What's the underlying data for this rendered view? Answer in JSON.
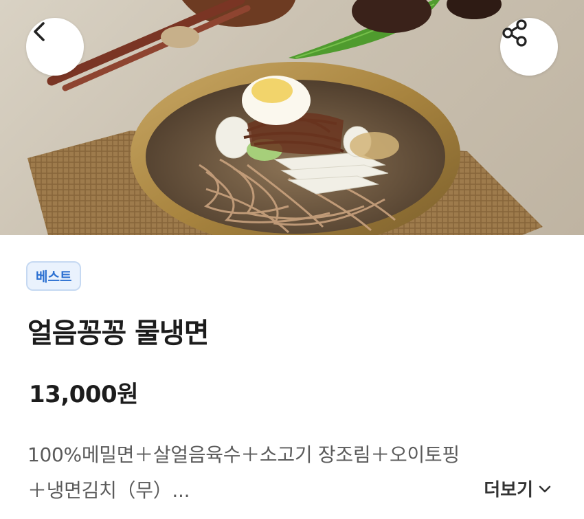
{
  "header": {
    "back_icon": "chevron-left-icon",
    "share_icon": "share-icon",
    "photo_subject": "cold buckwheat noodles (mul-naengmyeon) in a brass bowl"
  },
  "product": {
    "badge": "베스트",
    "name": "얼음꽁꽁 물냉면",
    "price": "13,000원",
    "description_line1": "100%메밀면＋살얼음육수＋소고기 장조림＋오이토핑",
    "description_line2": "＋냉면김치（무）...",
    "more_label": "더보기",
    "more_icon": "chevron-down-icon"
  },
  "colors": {
    "badge_text": "#2a6fd1",
    "badge_bg": "#eaf2fd",
    "badge_border": "#c6d9f2",
    "title": "#1c1c1c",
    "description": "#5b5b5b"
  }
}
